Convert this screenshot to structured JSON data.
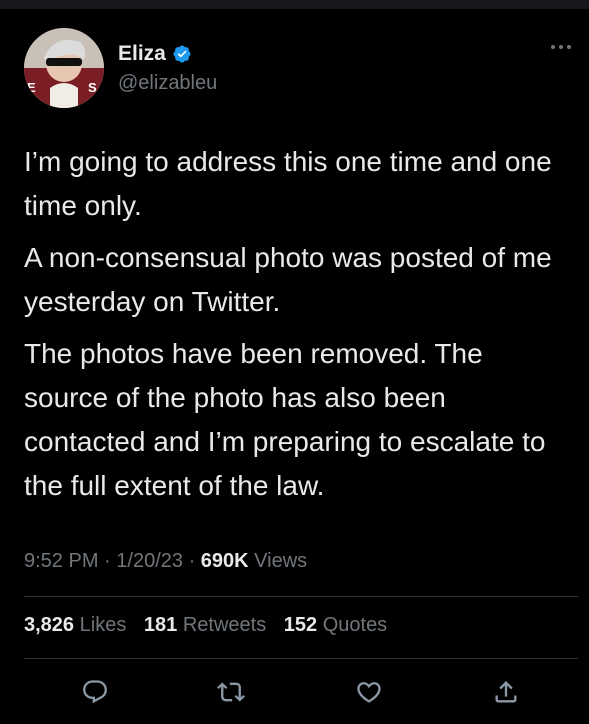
{
  "author": {
    "name": "Eliza",
    "handle": "@elizableu",
    "verified_color": "#1d9bf0",
    "avatar_caption": "E S"
  },
  "tweet": {
    "paragraphs": [
      "I’m going to address this one time and one time only.",
      "A non-consensual photo was posted of me yesterday on Twitter.",
      "The photos have been removed. The source of the photo has also been contacted and I’m preparing to escalate to the full extent of the law."
    ]
  },
  "meta": {
    "time": "9:52 PM",
    "date": "1/20/23",
    "views_count": "690K",
    "views_label": "Views"
  },
  "stats": {
    "likes_count": "3,826",
    "likes_label": "Likes",
    "retweets_count": "181",
    "retweets_label": "Retweets",
    "quotes_count": "152",
    "quotes_label": "Quotes"
  },
  "icons": {
    "more": "more-icon",
    "reply": "reply-icon",
    "retweet": "retweet-icon",
    "like": "like-icon",
    "share": "share-icon"
  },
  "colors": {
    "background": "#000000",
    "text": "#e7e9ea",
    "secondary": "#71767b",
    "divider": "#2f3336"
  }
}
